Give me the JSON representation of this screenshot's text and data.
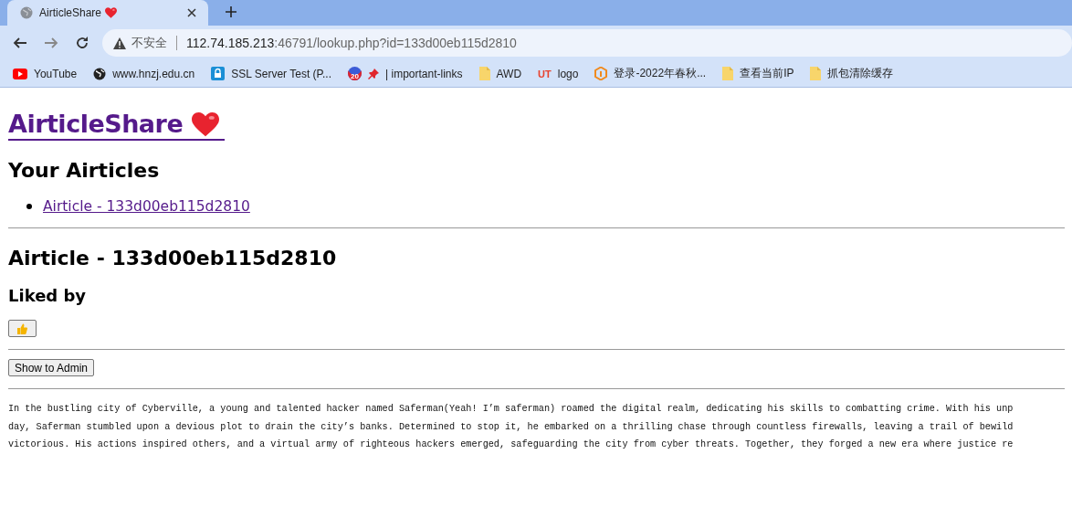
{
  "browser": {
    "tab": {
      "title": "AirticleShare",
      "selected": true
    },
    "nav": [
      {
        "kind": "back",
        "disabled": false
      },
      {
        "kind": "forward",
        "disabled": true
      },
      {
        "kind": "reload",
        "disabled": false
      }
    ],
    "address": {
      "security": "不安全",
      "host": "112.74.185.213",
      "path": ":46791/lookup.php?id=133d00eb115d2810"
    },
    "bookmarks": [
      {
        "kind": "youtube",
        "label": "YouTube"
      },
      {
        "kind": "globe",
        "label": "www.hnzj.edu.cn"
      },
      {
        "kind": "lock",
        "label": "SSL Server Test (P..."
      },
      {
        "kind": "badge",
        "badge": "20",
        "label": "| important-links"
      },
      {
        "kind": "folder",
        "label": "AWD"
      },
      {
        "kind": "letters",
        "icon_text": "UT",
        "label": "logo"
      },
      {
        "kind": "hex",
        "label": "登录-2022年春秋..."
      },
      {
        "kind": "folder",
        "label": "查看当前IP"
      },
      {
        "kind": "folder",
        "label": "抓包清除缓存"
      }
    ]
  },
  "page": {
    "title": "AirticleShare",
    "articles_heading": "Your Airticles",
    "articles": [
      "Airticle - 133d00eb115d2810"
    ],
    "article_heading": "Airticle - 133d00eb115d2810",
    "liked_heading": "Liked by",
    "admin_button": "Show to Admin",
    "story_lines": [
      "In the bustling city of Cyberville, a young and talented hacker named Saferman(Yeah! I’m saferman) roamed the digital realm, dedicating his skills to combatting crime. With his unp",
      "day, Saferman stumbled upon a devious plot to drain the city’s banks. Determined to stop it, he embarked on a thrilling chase through countless firewalls, leaving a trail of bewild",
      "victorious. His actions inspired others, and a virtual army of righteous hackers emerged, safeguarding the city from cyber threats. Together, they forged a new era where justice re"
    ]
  }
}
